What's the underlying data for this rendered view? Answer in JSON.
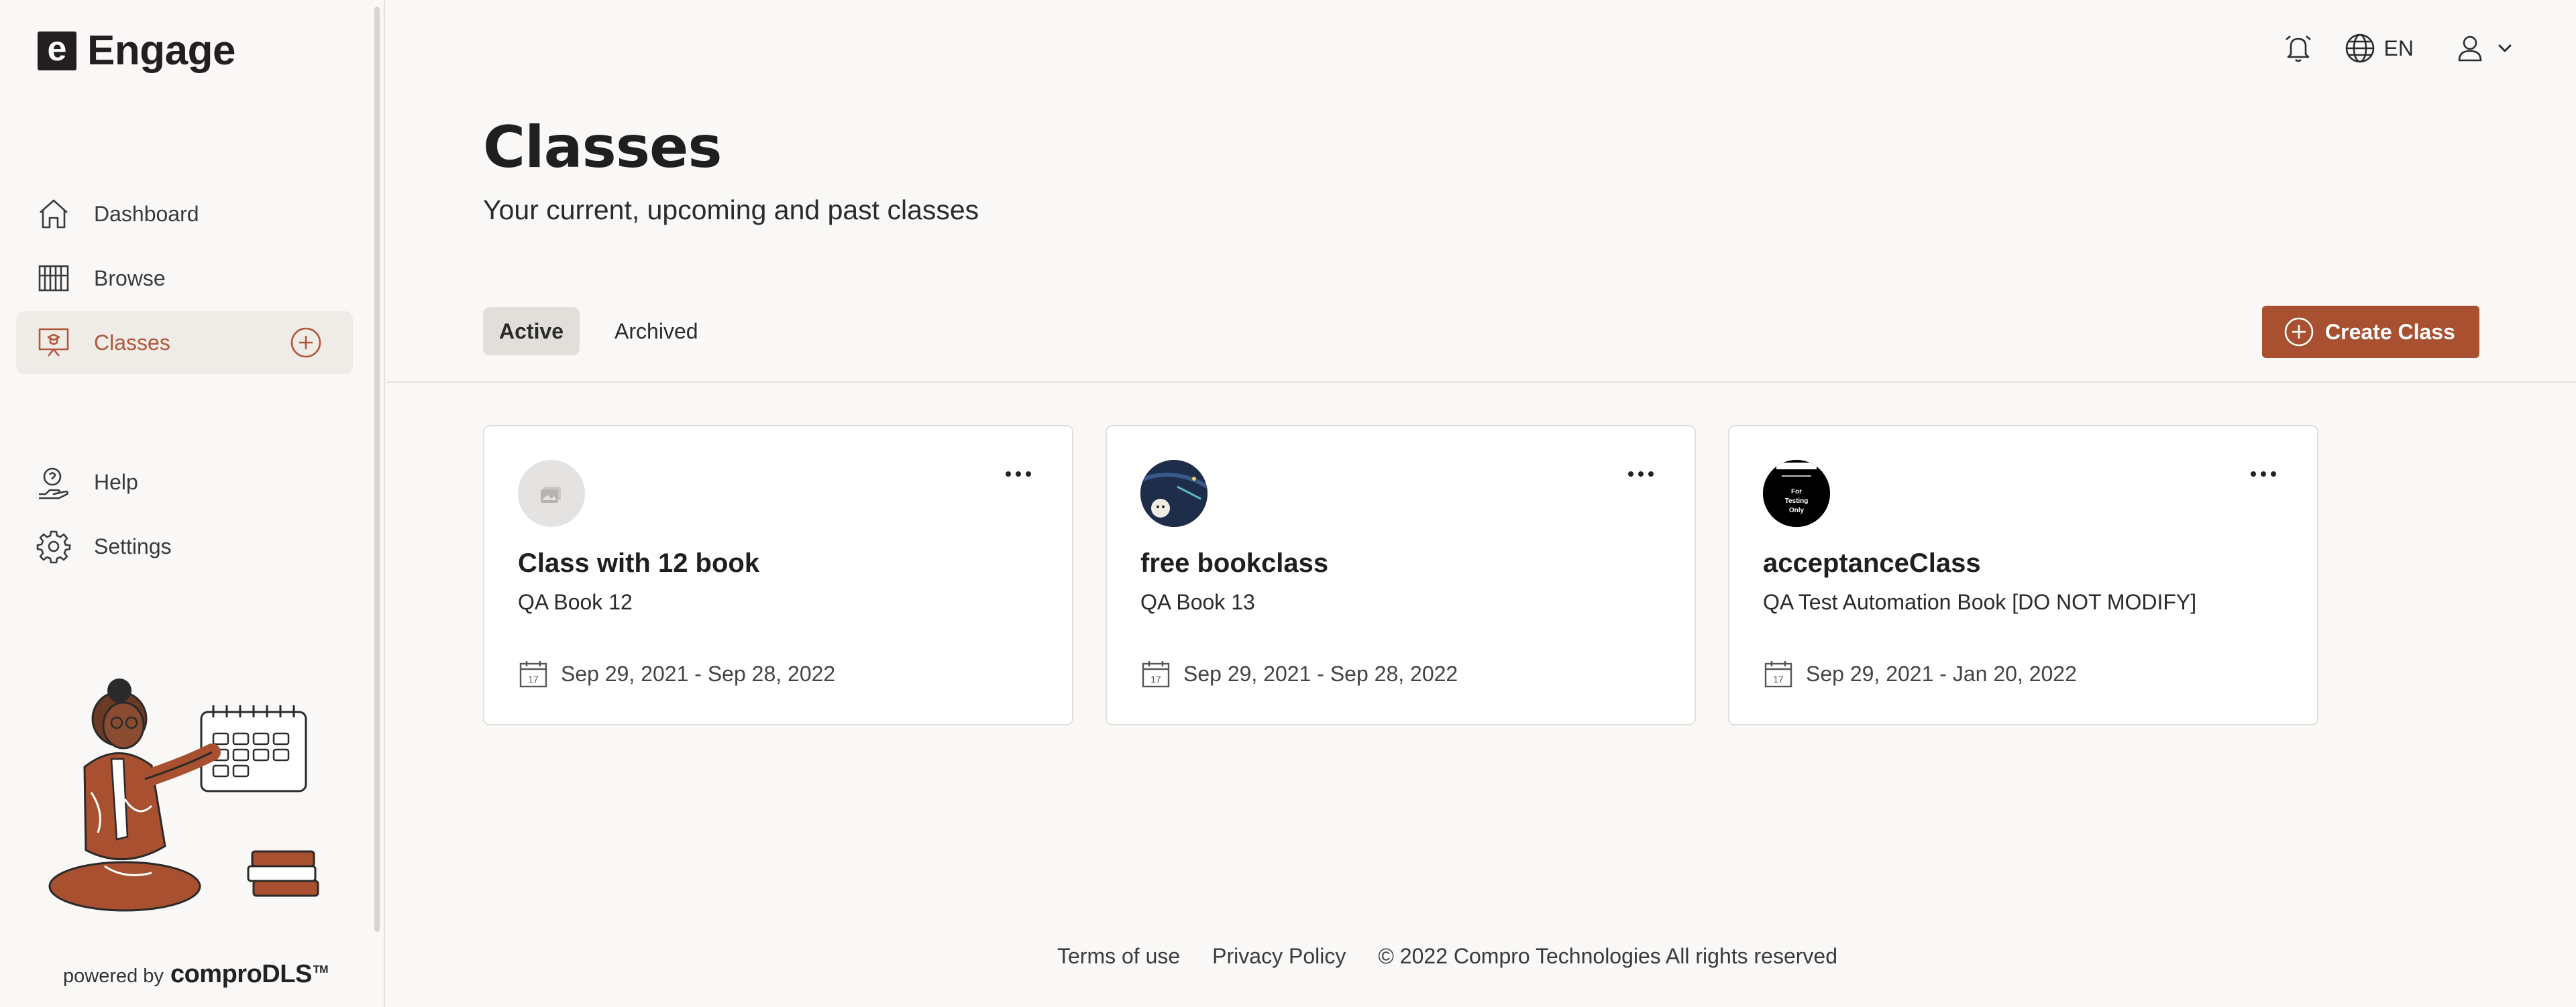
{
  "brand": {
    "mark": "e",
    "name": "Engage"
  },
  "sidebar": {
    "items": [
      {
        "label": "Dashboard",
        "icon": "home-icon"
      },
      {
        "label": "Browse",
        "icon": "books-icon"
      },
      {
        "label": "Classes",
        "icon": "presentation-icon",
        "active": true
      },
      {
        "label": "Help",
        "icon": "help-icon"
      },
      {
        "label": "Settings",
        "icon": "gear-icon"
      }
    ],
    "powered_by": "powered by",
    "powered_logo": "comproDLS",
    "powered_tm": "TM"
  },
  "header": {
    "language": "EN",
    "icons": [
      "alarm-bell-icon",
      "globe-icon",
      "user-icon",
      "chevron-down-icon"
    ]
  },
  "page": {
    "title": "Classes",
    "subtitle": "Your current, upcoming and past classes"
  },
  "tabs": [
    {
      "label": "Active",
      "active": true
    },
    {
      "label": "Archived",
      "active": false
    }
  ],
  "create_button": {
    "label": "Create Class",
    "icon": "plus-circle-icon"
  },
  "classes": [
    {
      "title": "Class with 12 book",
      "book": "QA Book 12",
      "dates": "Sep 29, 2021 - Sep 28, 2022",
      "avatar": "placeholder-image-icon"
    },
    {
      "title": "free bookclass",
      "book": "QA Book 13",
      "dates": "Sep 29, 2021 - Sep 28, 2022",
      "avatar": "book-cover-thumbnail"
    },
    {
      "title": "acceptanceClass",
      "book": "QA Test Automation Book [DO NOT MODIFY]",
      "dates": "Sep 29, 2021 - Jan 20, 2022",
      "avatar": "book-cover-thumbnail",
      "avatar_lines": [
        "For",
        "Testing",
        "Only"
      ]
    }
  ],
  "calendar_day": "17",
  "footer": {
    "terms": "Terms of use",
    "privacy": "Privacy Policy",
    "copyright": "© 2022 Compro Technologies All rights reserved"
  },
  "colors": {
    "accent": "#a8502f",
    "background": "#f9f8f6",
    "active_nav": "#b0573a"
  }
}
